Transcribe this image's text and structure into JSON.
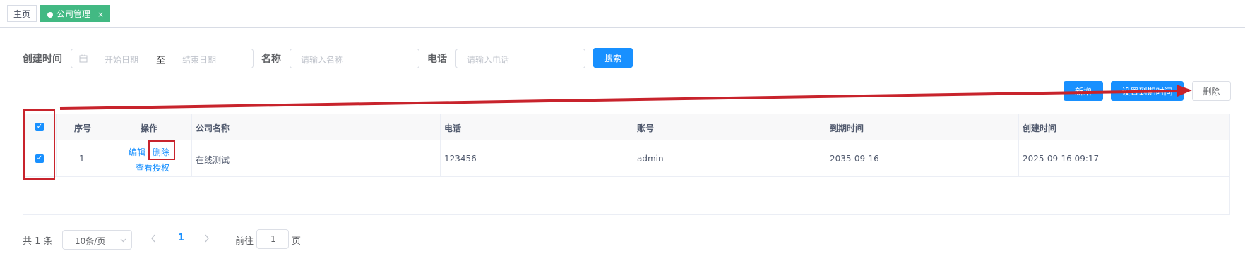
{
  "tabs": [
    {
      "label": "主页"
    },
    {
      "label": "公司管理",
      "close": "×"
    }
  ],
  "filters": {
    "create_time_label": "创建时间",
    "start_placeholder": "开始日期",
    "range_separator": "至",
    "end_placeholder": "结束日期",
    "name_label": "名称",
    "name_placeholder": "请输入名称",
    "phone_label": "电话",
    "phone_placeholder": "请输入电话",
    "search_button": "搜索"
  },
  "toolbar": {
    "add_button": "新增",
    "set_expiry_button": "设置到期时间",
    "delete_button": "删除"
  },
  "table": {
    "headers": [
      "序号",
      "操作",
      "公司名称",
      "电话",
      "账号",
      "到期时间",
      "创建时间"
    ],
    "rows": [
      {
        "index": "1",
        "actions": {
          "edit": "编辑",
          "delete": "删除",
          "view_auth": "查看授权"
        },
        "company_name": "在线测试",
        "phone": "123456",
        "account": "admin",
        "expire_time": "2035-09-16",
        "create_time": "2025-09-16 09:17"
      }
    ]
  },
  "pagination": {
    "total": "共 1 条",
    "page_size": "10条/页",
    "current_page": "1",
    "goto_label": "前往",
    "goto_value": "1",
    "page_suffix": "页"
  },
  "colors": {
    "primary": "#1890ff",
    "tag_active": "#42b983",
    "annotation_red": "#c8232c"
  }
}
